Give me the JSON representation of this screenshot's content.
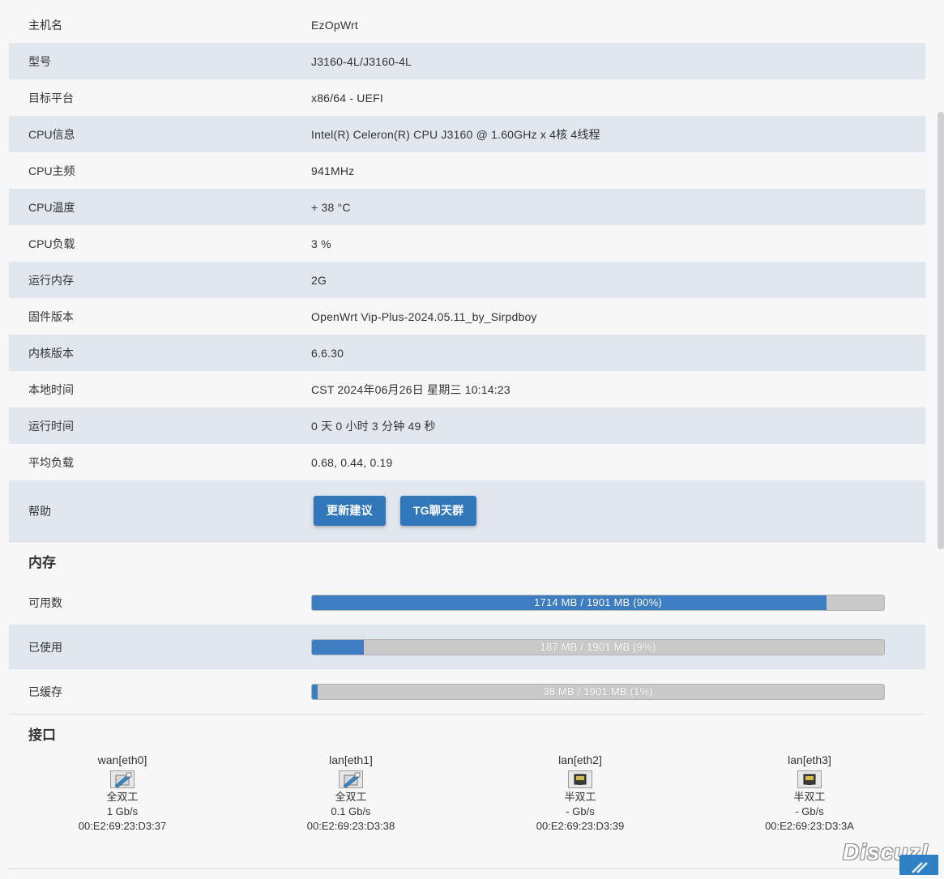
{
  "system": {
    "hostname": {
      "label": "主机名",
      "value": "EzOpWrt"
    },
    "model": {
      "label": "型号",
      "value": "J3160-4L/J3160-4L"
    },
    "platform": {
      "label": "目标平台",
      "value": "x86/64 - UEFI"
    },
    "cpu_info": {
      "label": "CPU信息",
      "value": "Intel(R) Celeron(R) CPU J3160 @ 1.60GHz x 4核 4线程"
    },
    "cpu_freq": {
      "label": "CPU主频",
      "value": "941MHz"
    },
    "cpu_temp": {
      "label": "CPU温度",
      "value": "+ 38 °C"
    },
    "cpu_load": {
      "label": "CPU负载",
      "value": "3 %"
    },
    "ram": {
      "label": "运行内存",
      "value": "2G"
    },
    "firmware": {
      "label": "固件版本",
      "value": "OpenWrt Vip-Plus-2024.05.11_by_Sirpdboy"
    },
    "kernel": {
      "label": "内核版本",
      "value": "6.6.30"
    },
    "local_time": {
      "label": "本地时间",
      "value": "CST 2024年06月26日 星期三 10:14:23"
    },
    "uptime": {
      "label": "运行时间",
      "value": "0 天 0 小时 3 分钟 49 秒"
    },
    "load_avg": {
      "label": "平均负载",
      "value": "0.68, 0.44, 0.19"
    },
    "help": {
      "label": "帮助",
      "button1": "更新建议",
      "button2": "TG聊天群"
    }
  },
  "memory": {
    "title": "内存",
    "available": {
      "label": "可用数",
      "text": "1714 MB / 1901 MB (90%)",
      "percent": 90
    },
    "used": {
      "label": "已使用",
      "text": "187 MB / 1901 MB (9%)",
      "percent": 9
    },
    "cached": {
      "label": "已缓存",
      "text": "38 MB / 1901 MB (1%)",
      "percent": 1
    }
  },
  "interfaces": {
    "title": "接口",
    "items": [
      {
        "name": "wan[eth0]",
        "duplex": "全双工",
        "speed": "1 Gb/s",
        "mac": "00:E2:69:23:D3:37",
        "status": "up"
      },
      {
        "name": "lan[eth1]",
        "duplex": "全双工",
        "speed": "0.1 Gb/s",
        "mac": "00:E2:69:23:D3:38",
        "status": "up"
      },
      {
        "name": "lan[eth2]",
        "duplex": "半双工",
        "speed": "- Gb/s",
        "mac": "00:E2:69:23:D3:39",
        "status": "down"
      },
      {
        "name": "lan[eth3]",
        "duplex": "半双工",
        "speed": "- Gb/s",
        "mac": "00:E2:69:23:D3:3A",
        "status": "down"
      }
    ]
  },
  "watermark": "Discuz!",
  "colors": {
    "accent": "#3277ba",
    "bar_fill": "#3d7ec2",
    "alt_row": "#e1e7ef"
  }
}
